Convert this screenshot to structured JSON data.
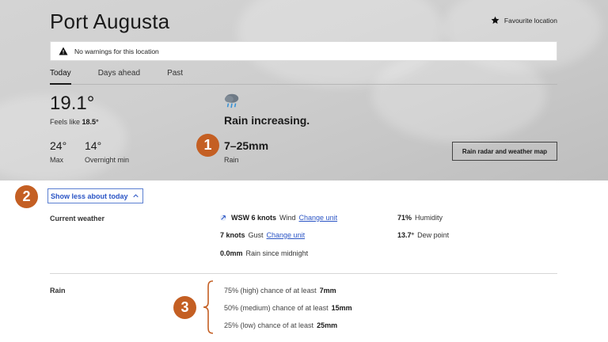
{
  "header": {
    "title": "Port Augusta",
    "favourite_label": "Favourite location",
    "warning_text": "No warnings for this location",
    "tabs": [
      "Today",
      "Days ahead",
      "Past"
    ]
  },
  "today": {
    "temp": "19.1°",
    "feels_like_label": "Feels like",
    "feels_like_value": "18.5°",
    "max_value": "24°",
    "max_label": "Max",
    "min_value": "14°",
    "min_label": "Overnight min",
    "forecast": "Rain increasing.",
    "rain_range": "7–25mm",
    "rain_label": "Rain",
    "radar_button": "Rain radar and weather map",
    "weather_icon": "rain-cloud-icon"
  },
  "badges": [
    "1",
    "2",
    "3"
  ],
  "details": {
    "show_less": "Show less about today",
    "current_label": "Current weather",
    "wind_value": "WSW 6 knots",
    "wind_label": "Wind",
    "change_unit": "Change unit",
    "gust_value": "7 knots",
    "gust_label": "Gust",
    "rain_midnight_value": "0.0mm",
    "rain_midnight_label": "Rain since midnight",
    "humidity_value": "71%",
    "humidity_label": "Humidity",
    "dew_value": "13.7°",
    "dew_label": "Dew point",
    "rain_section_label": "Rain",
    "chances": [
      {
        "text": "75% (high) chance of at least",
        "amount": "7mm"
      },
      {
        "text": "50% (medium) chance of at least",
        "amount": "15mm"
      },
      {
        "text": "25% (low) chance of at least",
        "amount": "25mm"
      }
    ]
  },
  "colors": {
    "badge": "#c45f23",
    "link": "#2b55c5"
  }
}
